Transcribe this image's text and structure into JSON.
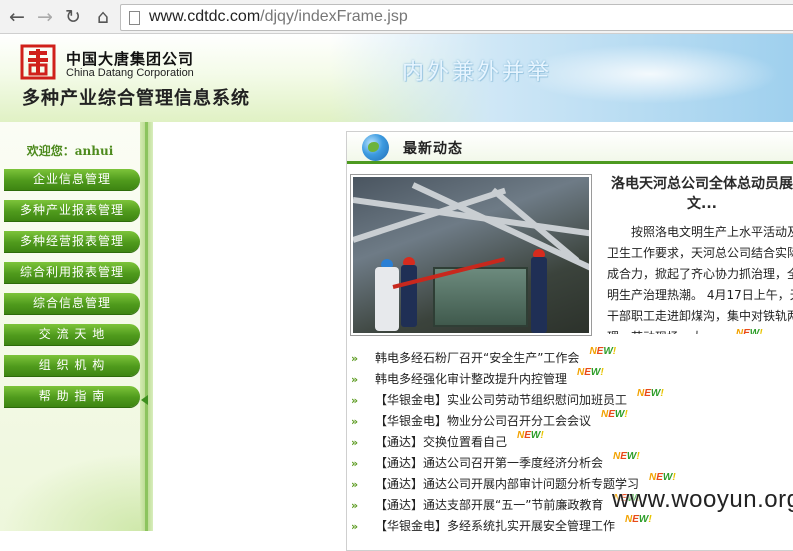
{
  "browser": {
    "url_host": "www.cdtdc.com",
    "url_path": "/djqy/indexFrame.jsp",
    "back_icon": "←",
    "forward_icon": "→",
    "reload_icon": "↻",
    "home_icon": "⌂"
  },
  "header": {
    "company_cn": "中国大唐集团公司",
    "company_en": "China Datang Corporation",
    "system_title": "多种产业综合管理信息系统",
    "slogan": "内外兼外并举"
  },
  "sidebar": {
    "welcome_label": "欢迎您：",
    "username": "anhui",
    "menu": [
      {
        "label": "企业信息管理"
      },
      {
        "label": "多种产业报表管理"
      },
      {
        "label": "多种经营报表管理"
      },
      {
        "label": "综合利用报表管理"
      },
      {
        "label": "综合信息管理"
      },
      {
        "label": "交 流 天 地"
      },
      {
        "label": "组 织 机 构"
      },
      {
        "label": "帮 助 指 南"
      }
    ]
  },
  "news": {
    "section_title": "最新动态",
    "featured": {
      "headline": "洛电天河总公司全体总动员展文...",
      "summary": "按照洛电文明生产上水平活动及卫生工作要求，天河总公司结合实际成合力，掀起了齐心协力抓治理，全明生产治理热潮。 4月17日上午，天干部职工走进卸煤沟，集中对铁轨两理。劳动现场，大......"
    },
    "new_badge": "NEW!",
    "items": [
      {
        "title": "韩电多经石粉厂召开“安全生产”工作会"
      },
      {
        "title": "韩电多经强化审计整改提升内控管理"
      },
      {
        "title": "【华银金电】实业公司劳动节组织慰问加班员工"
      },
      {
        "title": "【华银金电】物业分公司召开分工会会议"
      },
      {
        "title": "【通达】交换位置看自己"
      },
      {
        "title": "【通达】通达公司召开第一季度经济分析会"
      },
      {
        "title": "【通达】通达公司开展内部审计问题分析专题学习"
      },
      {
        "title": "【通达】通达支部开展“五一”节前廉政教育"
      },
      {
        "title": "【华银金电】多经系统扎实开展安全管理工作"
      }
    ]
  },
  "watermark": "www.wooyun.org",
  "colors": {
    "menu_green": "#4f9a1c",
    "accent_green": "#3d8f1e",
    "logo_red": "#d0201a"
  }
}
